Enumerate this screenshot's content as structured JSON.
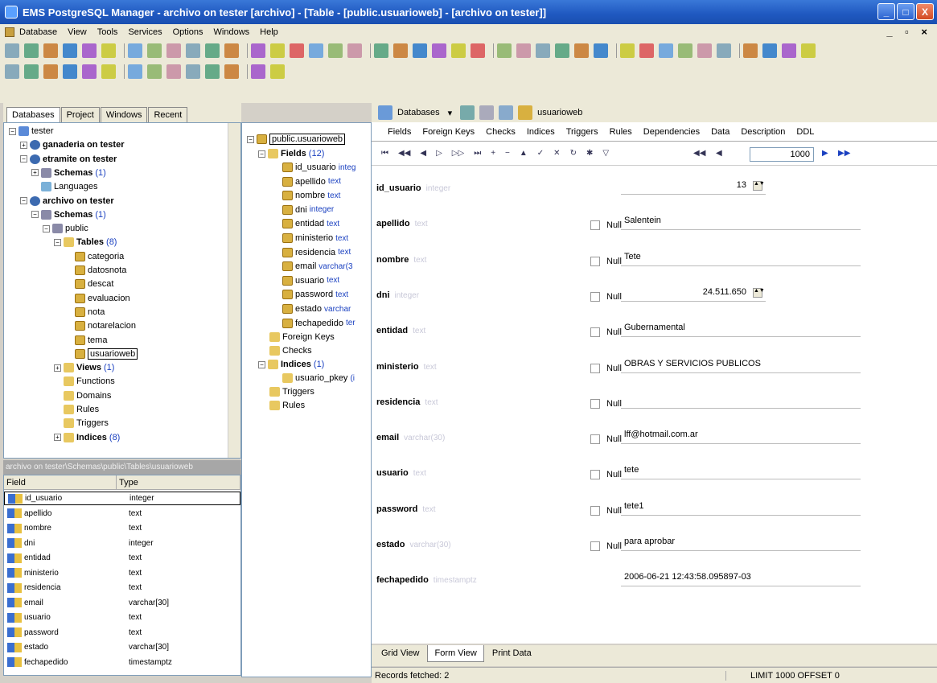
{
  "window": {
    "title": "EMS PostgreSQL Manager - archivo on tester [archivo] - [Table - [public.usuarioweb] - [archivo on tester]]",
    "controls": [
      "_",
      "□",
      "X"
    ],
    "mdi_controls": "_ ▫ ×"
  },
  "menu": [
    "Database",
    "View",
    "Tools",
    "Services",
    "Options",
    "Windows",
    "Help"
  ],
  "nav_tabs": [
    "Databases",
    "Project",
    "Windows",
    "Recent"
  ],
  "tree": [
    {
      "label": "tester",
      "level": 0,
      "exp": "-",
      "icon": "db",
      "bold": false
    },
    {
      "label": "ganaderia on tester",
      "level": 1,
      "exp": "+",
      "icon": "server",
      "bold": true
    },
    {
      "label": "etramite on tester",
      "level": 1,
      "exp": "-",
      "icon": "server",
      "bold": true
    },
    {
      "label": "Schemas",
      "count": "(1)",
      "level": 2,
      "exp": "+",
      "icon": "schema",
      "bold": true
    },
    {
      "label": "Languages",
      "level": 2,
      "exp": "",
      "icon": "lang",
      "bold": false
    },
    {
      "label": "archivo on tester",
      "level": 1,
      "exp": "-",
      "icon": "server",
      "bold": true
    },
    {
      "label": "Schemas",
      "count": "(1)",
      "level": 2,
      "exp": "-",
      "icon": "schema",
      "bold": true
    },
    {
      "label": "public",
      "level": 3,
      "exp": "-",
      "icon": "schema",
      "bold": false
    },
    {
      "label": "Tables",
      "count": "(8)",
      "level": 4,
      "exp": "-",
      "icon": "folder",
      "bold": true
    },
    {
      "label": "categoria",
      "level": 5,
      "exp": "",
      "icon": "table",
      "bold": false
    },
    {
      "label": "datosnota",
      "level": 5,
      "exp": "",
      "icon": "table",
      "bold": false
    },
    {
      "label": "descat",
      "level": 5,
      "exp": "",
      "icon": "table",
      "bold": false
    },
    {
      "label": "evaluacion",
      "level": 5,
      "exp": "",
      "icon": "table",
      "bold": false
    },
    {
      "label": "nota",
      "level": 5,
      "exp": "",
      "icon": "table",
      "bold": false
    },
    {
      "label": "notarelacion",
      "level": 5,
      "exp": "",
      "icon": "table",
      "bold": false
    },
    {
      "label": "tema",
      "level": 5,
      "exp": "",
      "icon": "table",
      "bold": false
    },
    {
      "label": "usuarioweb",
      "level": 5,
      "exp": "",
      "icon": "table",
      "bold": false,
      "selected": true
    },
    {
      "label": "Views",
      "count": "(1)",
      "level": 4,
      "exp": "+",
      "icon": "folder",
      "bold": true
    },
    {
      "label": "Functions",
      "level": 4,
      "exp": "",
      "icon": "folder",
      "bold": false
    },
    {
      "label": "Domains",
      "level": 4,
      "exp": "",
      "icon": "folder",
      "bold": false
    },
    {
      "label": "Rules",
      "level": 4,
      "exp": "",
      "icon": "folder",
      "bold": false
    },
    {
      "label": "Triggers",
      "level": 4,
      "exp": "",
      "icon": "folder",
      "bold": false
    },
    {
      "label": "Indices",
      "count": "(8)",
      "level": 4,
      "exp": "+",
      "icon": "folder",
      "bold": true
    }
  ],
  "path_bar": "archivo on tester\\Schemas\\public\\Tables\\usuarioweb",
  "field_list": {
    "headers": [
      "Field",
      "Type"
    ],
    "rows": [
      [
        "id_usuario",
        "integer"
      ],
      [
        "apellido",
        "text"
      ],
      [
        "nombre",
        "text"
      ],
      [
        "dni",
        "integer"
      ],
      [
        "entidad",
        "text"
      ],
      [
        "ministerio",
        "text"
      ],
      [
        "residencia",
        "text"
      ],
      [
        "email",
        "varchar[30]"
      ],
      [
        "usuario",
        "text"
      ],
      [
        "password",
        "text"
      ],
      [
        "estado",
        "varchar[30]"
      ],
      [
        "fechapedido",
        "timestamptz"
      ]
    ]
  },
  "mid_tree": {
    "root": "public.usuarioweb",
    "fields_label": "Fields",
    "fields_count": "(12)",
    "fields": [
      [
        "id_usuario",
        "integ"
      ],
      [
        "apellido",
        "text"
      ],
      [
        "nombre",
        "text"
      ],
      [
        "dni",
        "integer"
      ],
      [
        "entidad",
        "text"
      ],
      [
        "ministerio",
        "text"
      ],
      [
        "residencia",
        "text"
      ],
      [
        "email",
        "varchar(3"
      ],
      [
        "usuario",
        "text"
      ],
      [
        "password",
        "text"
      ],
      [
        "estado",
        "varchar"
      ],
      [
        "fechapedido",
        "ter"
      ]
    ],
    "others": [
      "Foreign Keys",
      "Checks"
    ],
    "indices_label": "Indices",
    "indices_count": "(1)",
    "index_item": "usuario_pkey",
    "index_suffix": "(i",
    "tail": [
      "Triggers",
      "Rules"
    ]
  },
  "editor_toolbar": {
    "databases": "Databases",
    "object": "usuarioweb"
  },
  "editor_tabs": [
    "Fields",
    "Foreign Keys",
    "Checks",
    "Indices",
    "Triggers",
    "Rules",
    "Dependencies",
    "Data",
    "Description",
    "DDL"
  ],
  "nav_bar": {
    "limit": "1000"
  },
  "form": {
    "null_label": "Null",
    "fields": [
      {
        "name": "id_usuario",
        "type": "integer",
        "value": "13",
        "null": false
      },
      {
        "name": "apellido",
        "type": "text",
        "value": "Salentein",
        "null": true
      },
      {
        "name": "nombre",
        "type": "text",
        "value": "Tete",
        "null": true
      },
      {
        "name": "dni",
        "type": "integer",
        "value": "24.511.650",
        "null": true
      },
      {
        "name": "entidad",
        "type": "text",
        "value": "Gubernamental",
        "null": true
      },
      {
        "name": "ministerio",
        "type": "text",
        "value": "OBRAS Y SERVICIOS PUBLICOS",
        "null": true
      },
      {
        "name": "residencia",
        "type": "text",
        "value": "",
        "null": true
      },
      {
        "name": "email",
        "type": "varchar(30)",
        "value": "lff@hotmail.com.ar",
        "null": true
      },
      {
        "name": "usuario",
        "type": "text",
        "value": "tete",
        "null": true
      },
      {
        "name": "password",
        "type": "text",
        "value": "tete1",
        "null": true
      },
      {
        "name": "estado",
        "type": "varchar(30)",
        "value": "para aprobar",
        "null": true
      },
      {
        "name": "fechapedido",
        "type": "timestamptz",
        "value": "2006-06-21 12:43:58.095897-03",
        "null": false
      }
    ]
  },
  "view_tabs": [
    "Grid View",
    "Form View",
    "Print Data"
  ],
  "status": {
    "left": "Records fetched: 2",
    "right": "LIMIT 1000 OFFSET 0"
  },
  "colors": {
    "titlebar": "#1f58c0",
    "selection_box": "#000000",
    "link": "#1a40c0"
  }
}
